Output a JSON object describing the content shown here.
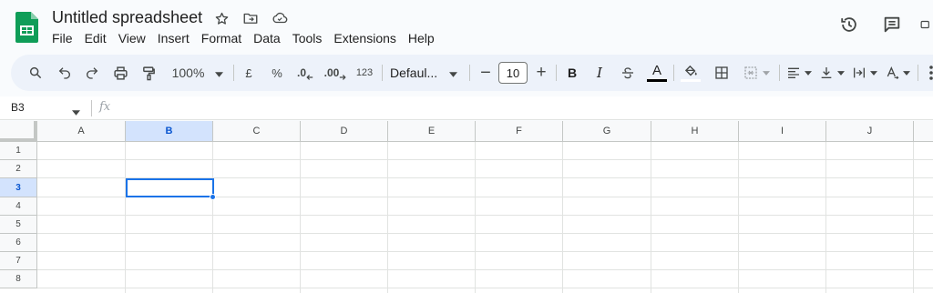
{
  "app": {
    "title": "Untitled spreadsheet",
    "brand_color": "#0f9d58",
    "accent_color": "#1a73e8"
  },
  "title_icons": [
    "star-icon",
    "move-to-folder-icon",
    "cloud-saved-icon"
  ],
  "menu": [
    "File",
    "Edit",
    "View",
    "Insert",
    "Format",
    "Data",
    "Tools",
    "Extensions",
    "Help"
  ],
  "header_actions": [
    "version-history-icon",
    "comments-icon",
    "video-call-icon"
  ],
  "toolbar": {
    "zoom": "100%",
    "currency": "£",
    "percent": "%",
    "decrease_decimal": ".0",
    "increase_decimal": ".00",
    "more_formats": "123",
    "font": "Defaul...",
    "minus": "−",
    "font_size": "10",
    "plus": "+",
    "bold": "B",
    "italic": "I",
    "text_color": "A"
  },
  "formula_bar": {
    "cell_ref": "B3",
    "fx": "fx",
    "value": ""
  },
  "grid": {
    "columns": [
      "A",
      "B",
      "C",
      "D",
      "E",
      "F",
      "G",
      "H",
      "I",
      "J"
    ],
    "rows": [
      "1",
      "2",
      "3",
      "4",
      "5",
      "6",
      "7",
      "8"
    ],
    "selected_cell": "B3",
    "selected_column": "B",
    "selected_row": "3"
  }
}
